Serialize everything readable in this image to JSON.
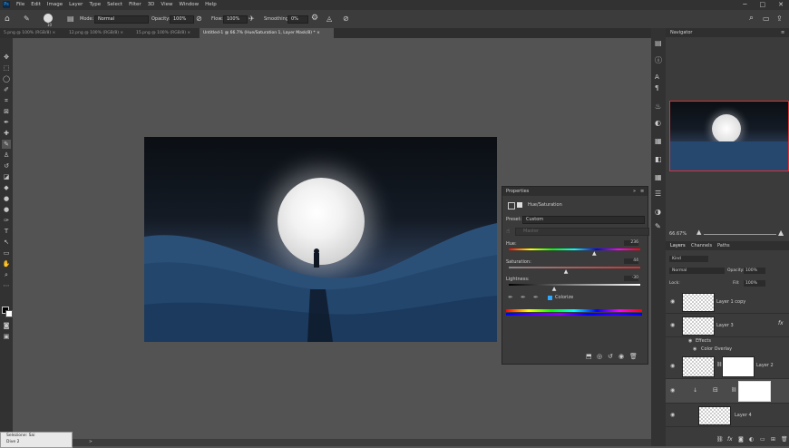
{
  "app": {
    "logo": "Ps",
    "min": "─",
    "max": "□",
    "close": "✕"
  },
  "menu": [
    "File",
    "Edit",
    "Image",
    "Layer",
    "Type",
    "Select",
    "Filter",
    "3D",
    "View",
    "Window",
    "Help"
  ],
  "options": {
    "mode_label": "Mode:",
    "mode_value": "Normal",
    "opacity_label": "Opacity:",
    "opacity_value": "100%",
    "flow_label": "Flow:",
    "flow_value": "100%",
    "smoothing_label": "Smoothing:",
    "smoothing_value": "0%",
    "brush_size": "10"
  },
  "tabs": [
    "5.png @ 100% (RGB/8)",
    "12.png @ 100% (RGB/8)",
    "15.png @ 100% (RGB/8)",
    "Untitled-1 @ 66.7% (Hue/Saturation 1, Layer Mask/8) *"
  ],
  "tab_close": "×",
  "properties": {
    "title": "Properties",
    "expand": "»",
    "menu": "≡",
    "adjustment": "Hue/Saturation",
    "preset_label": "Preset:",
    "preset_value": "Custom",
    "channel": "Master",
    "hue_label": "Hue:",
    "hue_value": "236",
    "hue": 236,
    "sat_label": "Saturation:",
    "sat_value": "44",
    "saturation": 44,
    "light_label": "Lightness:",
    "light_value": "-30",
    "lightness": -30,
    "colorize_label": "Colorize",
    "colorize": true
  },
  "navigator": {
    "title": "Navigator",
    "menu": "≡",
    "zoom": "66.67%"
  },
  "layers_panel": {
    "tabs": [
      "Layers",
      "Channels",
      "Paths"
    ],
    "filter": "Kind",
    "blend": "Normal",
    "opacity_label": "Opacity:",
    "opacity": "100%",
    "lock_label": "Lock:",
    "fill_label": "Fill:",
    "fill": "100%",
    "fx": "fx",
    "layers": [
      {
        "name": "Layer 1 copy"
      },
      {
        "name": "Layer 3"
      },
      {
        "name": "Effects"
      },
      {
        "name": "Color Overlay"
      },
      {
        "name": "Layer 2"
      },
      {
        "name": ""
      },
      {
        "name": "Layer 4"
      }
    ]
  },
  "status": {
    "zoom": "66.67%",
    "nav": ">"
  },
  "mini_panel": {
    "title": "Selezione: Sai",
    "value": "Dive 2"
  },
  "colors": {
    "accent": "#31a8ff",
    "panel": "#3b3b3b",
    "bg": "#535353"
  }
}
